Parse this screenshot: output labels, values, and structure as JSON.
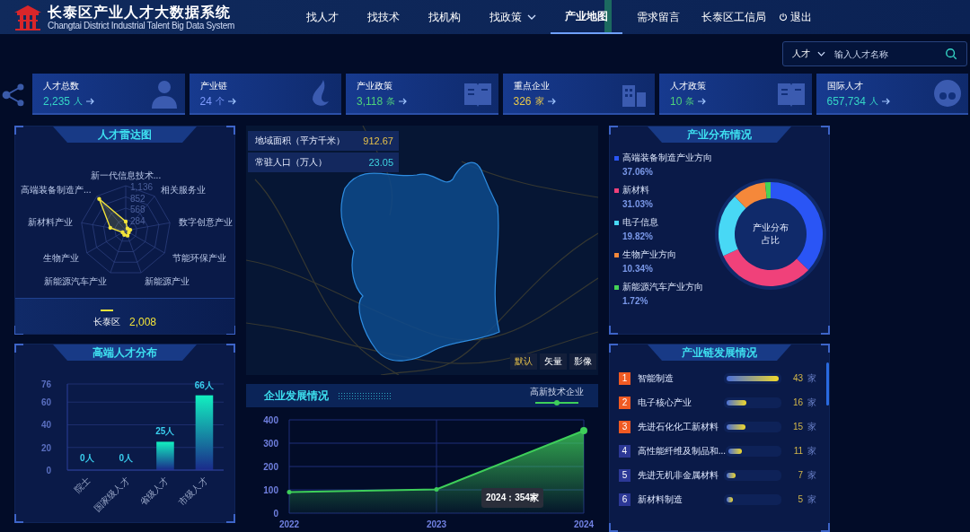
{
  "header": {
    "title": "长泰区产业人才大数据系统",
    "subtitle": "Changtai District Industrial Talent Big Data System",
    "nav": [
      {
        "label": "找人才",
        "selected": false,
        "has_menu": false
      },
      {
        "label": "找技术",
        "selected": false,
        "has_menu": false
      },
      {
        "label": "找机构",
        "selected": false,
        "has_menu": false
      },
      {
        "label": "找政策",
        "selected": false,
        "has_menu": true
      },
      {
        "label": "产业地图",
        "selected": true,
        "has_menu": false
      },
      {
        "label": "需求留言",
        "selected": false,
        "has_menu": false
      }
    ],
    "user": "长泰区工信局",
    "logout": "退出"
  },
  "search": {
    "category": "人才",
    "placeholder": "输入人才名称"
  },
  "stats": [
    {
      "label": "人才总数",
      "value": "2,235",
      "unit": "人",
      "color": "#35d6c6"
    },
    {
      "label": "产业链",
      "value": "24",
      "unit": "个",
      "color": "#7f9cff"
    },
    {
      "label": "产业政策",
      "value": "3,118",
      "unit": "条",
      "color": "#4fd27a"
    },
    {
      "label": "重点企业",
      "value": "326",
      "unit": "家",
      "color": "#e8c84a"
    },
    {
      "label": "人才政策",
      "value": "10",
      "unit": "条",
      "color": "#4fd27a"
    },
    {
      "label": "国际人才",
      "value": "657,734",
      "unit": "人",
      "color": "#35d6c6"
    }
  ],
  "radar": {
    "title": "人才雷达图",
    "axes": [
      "新一代信息技术...",
      "高端装备制造产...",
      "相关服务业",
      "新材料产业",
      "数字创意产业",
      "生物产业",
      "节能环保产业",
      "新能源汽车产业",
      "新能源产业"
    ],
    "ticks": [
      "1,136",
      "852",
      "568",
      "284"
    ],
    "legend": {
      "name": "长泰区",
      "value": "2,008",
      "color": "#f2e33a"
    }
  },
  "talent": {
    "title": "高端人才分布",
    "chart_data": {
      "type": "bar",
      "categories": [
        "院士",
        "国家级人才",
        "省级人才",
        "市级人才"
      ],
      "values": [
        0,
        0,
        25,
        66
      ],
      "ylim": [
        0,
        76
      ],
      "yticks": [
        0,
        20,
        40,
        60,
        76
      ],
      "grid": true,
      "value_labels": [
        "0人",
        "0人",
        "25人",
        "66人"
      ]
    }
  },
  "map": {
    "info": [
      {
        "label": "地域面积（平方千米）",
        "value": "912.67",
        "color": "#e8c24a"
      },
      {
        "label": "常驻人口（万人）",
        "value": "23.05",
        "color": "#3fd4e0"
      }
    ],
    "modes": [
      {
        "label": "默认",
        "selected": true
      },
      {
        "label": "矢量",
        "selected": false
      },
      {
        "label": "影像",
        "selected": false
      }
    ]
  },
  "enterprise": {
    "title": "企业发展情况",
    "chart_data": {
      "type": "area",
      "x": [
        "2022",
        "2023",
        "2024"
      ],
      "series": [
        {
          "name": "高新技术企业",
          "color": "#3ecf5a",
          "values": [
            90,
            102,
            354
          ]
        }
      ],
      "ylim": [
        0,
        400
      ],
      "yticks": [
        0,
        100,
        200,
        300,
        400
      ],
      "grid": true,
      "annotations": [
        "2024：354家"
      ]
    }
  },
  "distribution": {
    "title": "产业分布情况",
    "center_label": "产业分布占比",
    "legend": [
      {
        "percent": "37.06%",
        "color": "#2a55f5"
      },
      {
        "percent": "31.03%",
        "color": "#f0417a"
      },
      {
        "percent": "19.82%",
        "color": "#48d8f5"
      },
      {
        "percent": "10.34%",
        "color": "#f5883a"
      },
      {
        "percent": "1.72%",
        "color": "#45d356"
      }
    ],
    "chart_data": {
      "type": "donut",
      "categories": [
        "高端装备制造产业方向",
        "新材料",
        "电子信息",
        "生物产业方向",
        "新能源汽车产业方向"
      ],
      "values": [
        37.06,
        31.03,
        19.82,
        10.34,
        1.72
      ]
    }
  },
  "chain": {
    "title": "产业链发展情况",
    "items": [
      {
        "rank": "1",
        "name": "智能制造",
        "level": 1,
        "count": "43",
        "unit": "家",
        "top": true
      },
      {
        "rank": "2",
        "name": "电子核心产业",
        "level": 0.38,
        "count": "16",
        "unit": "家",
        "top": true
      },
      {
        "rank": "3",
        "name": "先进石化化工新材料",
        "level": 0.35,
        "count": "15",
        "unit": "家",
        "top": true
      },
      {
        "rank": "4",
        "name": "高性能纤维及制品和...",
        "level": 0.26,
        "count": "11",
        "unit": "家",
        "top": false
      },
      {
        "rank": "5",
        "name": "先进无机非金属材料",
        "level": 0.16,
        "count": "7",
        "unit": "家",
        "top": false
      },
      {
        "rank": "6",
        "name": "新材料制造",
        "level": 0.12,
        "count": "5",
        "unit": "家",
        "top": false
      }
    ]
  }
}
